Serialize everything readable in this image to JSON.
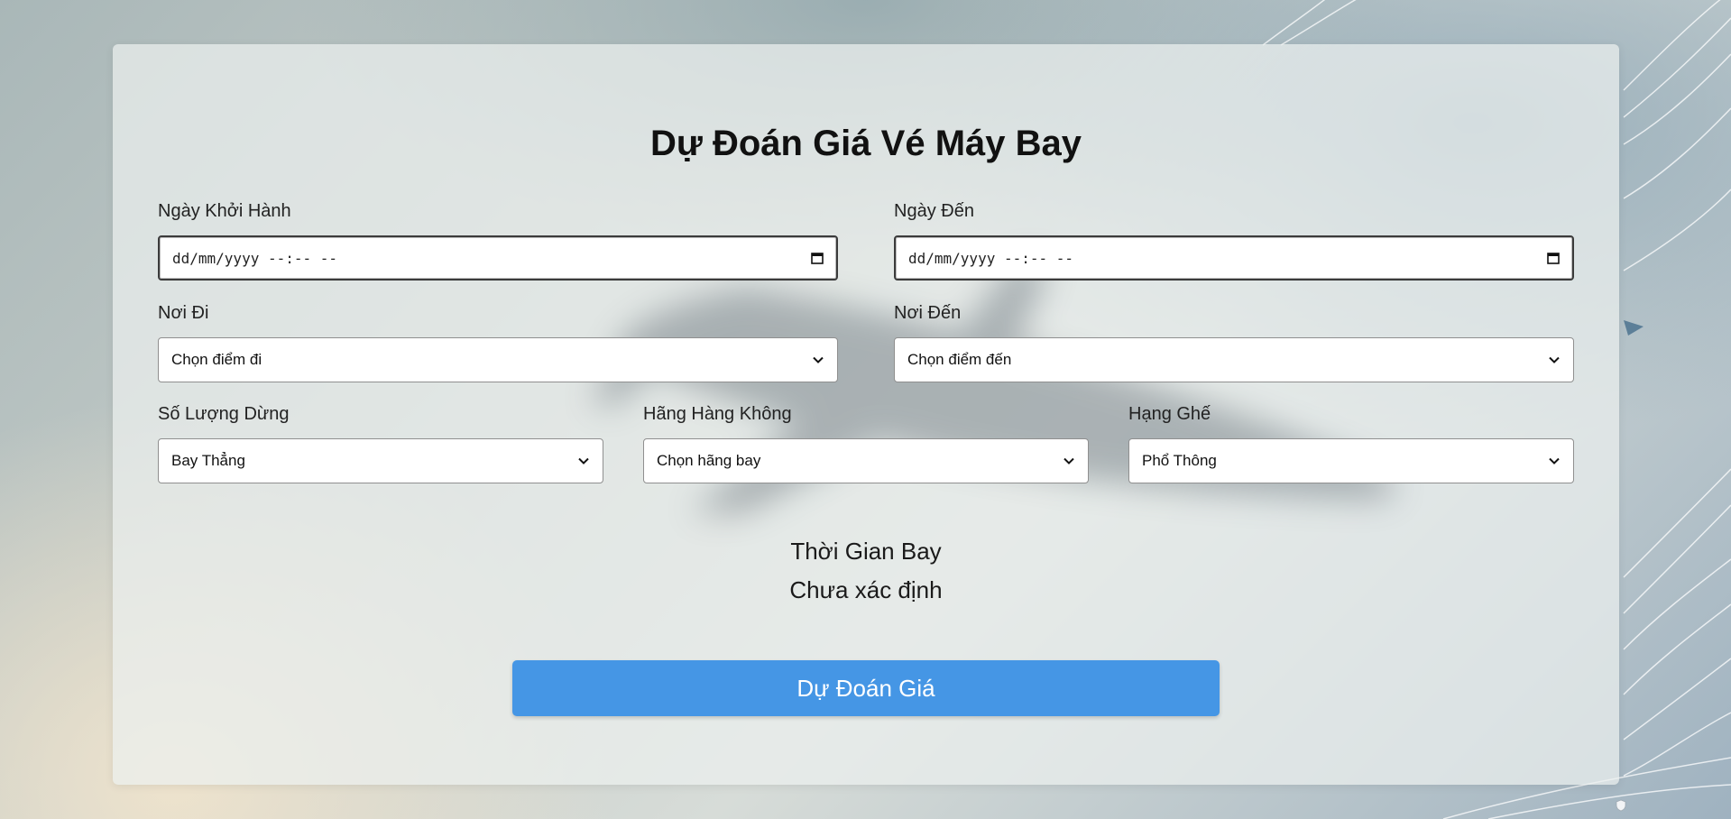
{
  "page": {
    "title": "Dự Đoán Giá Vé Máy Bay"
  },
  "form": {
    "departure_date": {
      "label": "Ngày Khởi Hành",
      "value": "dd/mm/yyyy --:-- --",
      "icon": "calendar-icon"
    },
    "arrival_date": {
      "label": "Ngày Đến",
      "value": "dd/mm/yyyy --:-- --",
      "icon": "calendar-icon"
    },
    "origin": {
      "label": "Nơi Đi",
      "selected": "Chọn điểm đi",
      "icon": "chevron-down-icon"
    },
    "destination": {
      "label": "Nơi Đến",
      "selected": "Chọn điểm đến",
      "icon": "chevron-down-icon"
    },
    "stops": {
      "label": "Số Lượng Dừng",
      "selected": "Bay Thẳng",
      "icon": "chevron-down-icon"
    },
    "airline": {
      "label": "Hãng Hàng Không",
      "selected": "Chọn hãng bay",
      "icon": "chevron-down-icon"
    },
    "seat_class": {
      "label": "Hạng Ghế",
      "selected": "Phổ Thông",
      "icon": "chevron-down-icon"
    }
  },
  "flight_time": {
    "label": "Thời Gian Bay",
    "value": "Chưa xác định"
  },
  "actions": {
    "predict_label": "Dự Đoán Giá"
  },
  "colors": {
    "primary_button": "#4596e5",
    "card_background": "#ecf0ee"
  }
}
